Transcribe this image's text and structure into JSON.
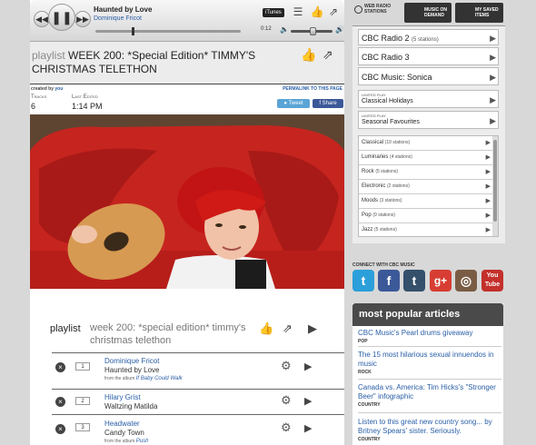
{
  "player": {
    "track_title": "Haunted by Love",
    "track_artist": "Dominique Fricot",
    "itunes_label": "iTunes",
    "time": "0:12",
    "progress_fraction": 0.25,
    "volume_fraction": 0.55
  },
  "playlist": {
    "prefix": "playlist",
    "title": "WEEK 200: *Special Edition* TIMMY'S CHRISTMAS TELETHON",
    "created_by_label": "created by",
    "created_by": "you",
    "permalink_label": "PERMALINK TO THIS PAGE",
    "tracks_label": "Tracks",
    "tracks_value": "6",
    "last_edited_label": "Last Edited",
    "last_edited_value": "1:14 PM",
    "tweet_label": "Tweet",
    "share_label": "Share",
    "lower_label": "playlist",
    "lower_title": "week 200: *special edition* timmy's christmas telethon",
    "tracks": [
      {
        "num": "1",
        "title": "Dominique Fricot",
        "subtitle": "Haunted by Love",
        "album_prefix": "from the album",
        "album": "If Baby Could Walk"
      },
      {
        "num": "2",
        "title": "Hilary Grist",
        "subtitle": "Waltzing Matilda",
        "album_prefix": "",
        "album": ""
      },
      {
        "num": "3",
        "title": "Headwater",
        "subtitle": "Candy Town",
        "album_prefix": "from the album",
        "album": "Push"
      }
    ]
  },
  "nav": {
    "web_radio": "WEB RADIO STATIONS",
    "music_on_demand": "MUSIC ON DEMAND",
    "my_saved_items": "MY SAVED ITEMS"
  },
  "stations": [
    {
      "name": "CBC Radio 2",
      "count": "(5 stations)"
    },
    {
      "name": "CBC Radio 3",
      "count": ""
    },
    {
      "name": "CBC Music: Sonica",
      "count": ""
    }
  ],
  "limited": [
    {
      "tag": "LIMITED PLAY",
      "name": "Classical Holidays"
    },
    {
      "tag": "LIMITED PLAY",
      "name": "Seasonal Favourites"
    }
  ],
  "genres": [
    {
      "name": "Classical",
      "count": "(10 stations)"
    },
    {
      "name": "Luminaries",
      "count": "(4 stations)"
    },
    {
      "name": "Rock",
      "count": "(5 stations)"
    },
    {
      "name": "Electronic",
      "count": "(2 stations)"
    },
    {
      "name": "Moods",
      "count": "(3 stations)"
    },
    {
      "name": "Pop",
      "count": "(9 stations)"
    },
    {
      "name": "Jazz",
      "count": "(5 stations)"
    }
  ],
  "connect": {
    "label": "CONNECT WITH CBC MUSIC",
    "networks": [
      {
        "icon": "twitter-icon",
        "glyph": "t",
        "color": "#2b9fd9"
      },
      {
        "icon": "facebook-icon",
        "glyph": "f",
        "color": "#3b5998"
      },
      {
        "icon": "tumblr-icon",
        "glyph": "t",
        "color": "#34506b"
      },
      {
        "icon": "google-plus-icon",
        "glyph": "g+",
        "color": "#d73d32"
      },
      {
        "icon": "instagram-icon",
        "glyph": "◎",
        "color": "#7a5c44"
      },
      {
        "icon": "youtube-icon",
        "glyph": "You Tube",
        "color": "#c4302b"
      }
    ]
  },
  "popular": {
    "heading": "most popular articles",
    "articles": [
      {
        "title": "CBC Music's Pearl drums giveaway",
        "category": "POP"
      },
      {
        "title": "The 15 most hilarious sexual innuendos in music",
        "category": "ROCK"
      },
      {
        "title": "Canada vs. America: Tim Hicks's \"Stronger Beer\" infographic",
        "category": "COUNTRY"
      },
      {
        "title": "Listen to this great new country song... by Britney Spears' sister. Seriously.",
        "category": "COUNTRY"
      }
    ]
  }
}
